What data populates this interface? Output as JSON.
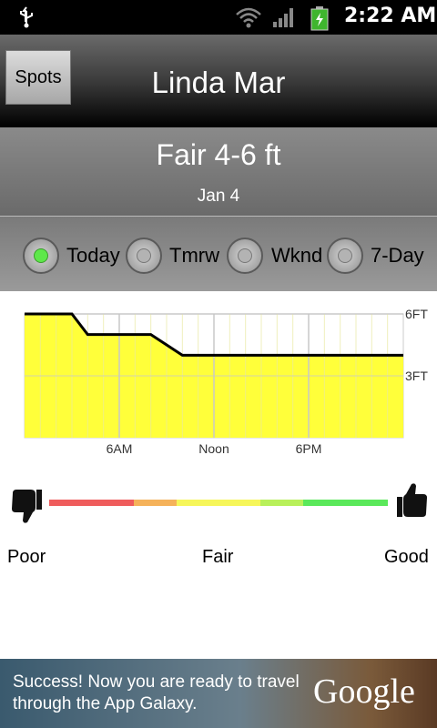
{
  "status_bar": {
    "time": "2:22 AM",
    "icons": [
      "usb-icon",
      "wifi-icon",
      "signal-icon",
      "battery-icon"
    ]
  },
  "header": {
    "back_button": "Spots",
    "title": "Linda Mar"
  },
  "forecast": {
    "summary": "Fair 4-6 ft",
    "date": "Jan 4"
  },
  "day_tabs": [
    {
      "label": "Today",
      "selected": true
    },
    {
      "label": "Tmrw",
      "selected": false
    },
    {
      "label": "Wknd",
      "selected": false
    },
    {
      "label": "7-Day",
      "selected": false
    }
  ],
  "chart_data": {
    "type": "area",
    "x_ticks": [
      "6AM",
      "Noon",
      "6PM"
    ],
    "y_ticks": [
      "6FT",
      "3FT"
    ],
    "x_hours": [
      0,
      3,
      4,
      8,
      10,
      24
    ],
    "y_ft": [
      6.0,
      6.0,
      5.0,
      5.0,
      4.0,
      4.0
    ],
    "xlim": [
      0,
      24
    ],
    "ylim": [
      0,
      6
    ],
    "fill_color": "#ffff3a",
    "line_color": "#000000",
    "grid": true
  },
  "rating": {
    "poor_label": "Poor",
    "fair_label": "Fair",
    "good_label": "Good",
    "colors": [
      "#ef5c5c",
      "#f5b25a",
      "#f6f65a",
      "#b8f05a",
      "#5ae85a"
    ]
  },
  "ad": {
    "text": "Success! Now you are ready to travel through the App Galaxy.",
    "logo": "Google"
  }
}
